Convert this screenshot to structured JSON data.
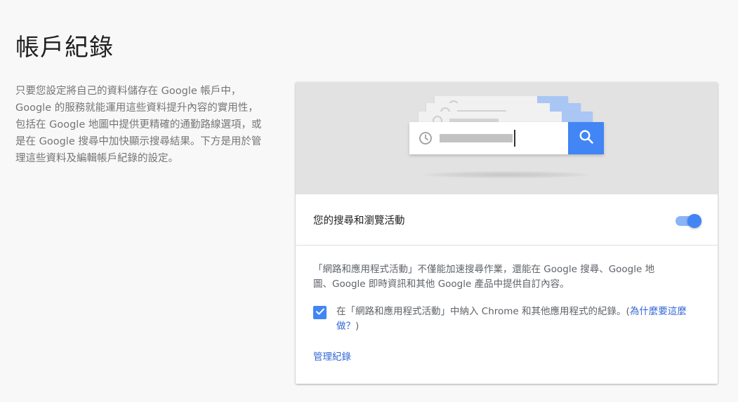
{
  "page": {
    "title": "帳戶紀錄",
    "intro": "只要您設定將自己的資料儲存在 Google 帳戶中，Google 的服務就能運用這些資料提升內容的實用性，包括在 Google 地圖中提供更精確的通勤路線選項，或是在 Google 搜尋中加快顯示搜尋結果。下方是用於管理這些資料及編輯帳戶紀錄的設定。"
  },
  "card": {
    "hero_icons": [
      "clock-icon",
      "search-icon"
    ],
    "setting": {
      "label": "您的搜尋和瀏覽活動",
      "enabled": true
    },
    "description": "「網路和應用程式活動」不僅能加速搜尋作業，還能在 Google 搜尋、Google 地圖、Google 即時資訊和其他 Google 產品中提供自訂內容。",
    "checkbox": {
      "checked": true,
      "text": "在「網路和應用程式活動」中納入 Chrome 和其他應用程式的紀錄。",
      "paren_open": "(",
      "link_label": "為什麼要這麼做？",
      "paren_close": ")"
    },
    "manage_label": "管理紀錄"
  },
  "colors": {
    "accent": "#4285f4",
    "link": "#3367d6",
    "page_bg": "#f8f8f8",
    "hero_bg": "#e2e2e2"
  }
}
